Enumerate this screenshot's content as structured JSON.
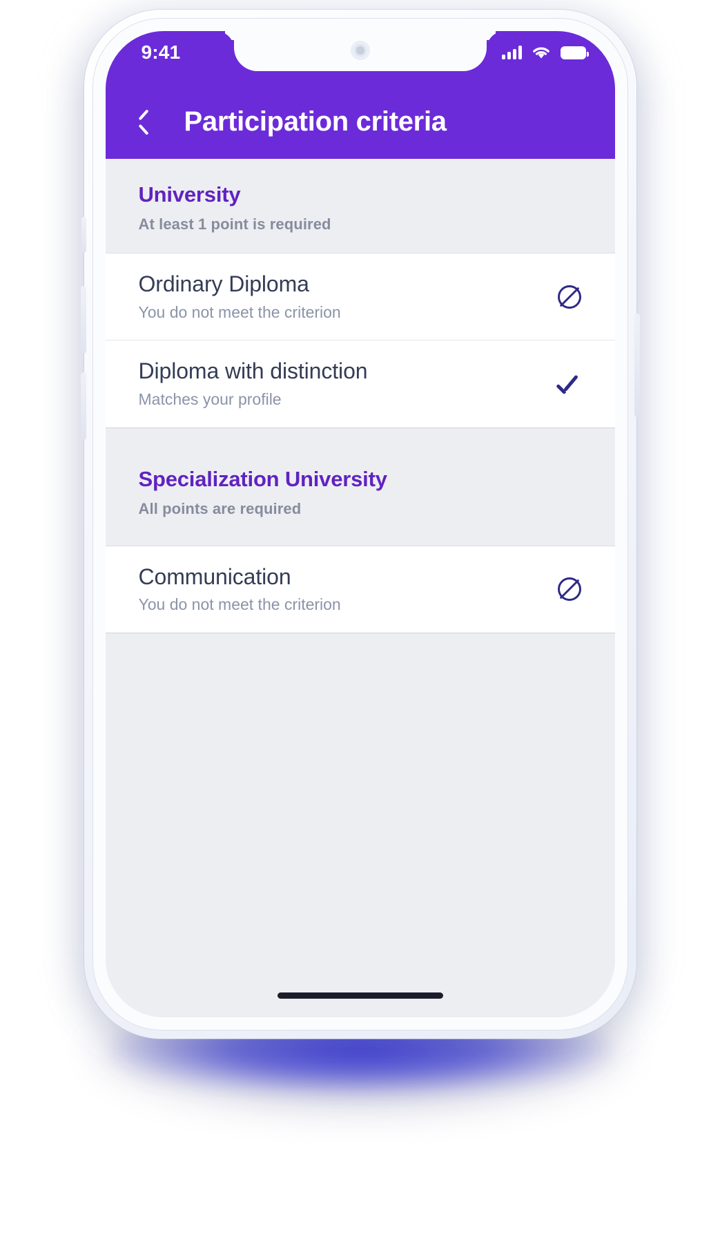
{
  "status_bar": {
    "time": "9:41",
    "icons": [
      "signal-icon",
      "wifi-icon",
      "battery-icon"
    ]
  },
  "header": {
    "title": "Participation criteria",
    "back_icon": "chevron-left-icon",
    "background_color": "#6c2bd9"
  },
  "colors": {
    "accent_purple": "#6c2bd9",
    "section_title_purple": "#6023c0",
    "icon_navy": "#2d2a86",
    "page_background": "#edeef2",
    "row_background": "#ffffff",
    "row_title": "#343c55",
    "row_subtitle": "#8b93a8",
    "section_subtitle": "#868c9d"
  },
  "sections": [
    {
      "title": "University",
      "subtitle": "At least 1 point is required",
      "items": [
        {
          "title": "Ordinary Diploma",
          "subtitle": "You do not meet the criterion",
          "status_icon": "circle-slash-icon"
        },
        {
          "title": "Diploma with distinction",
          "subtitle": "Matches your profile",
          "status_icon": "check-icon"
        }
      ]
    },
    {
      "title": "Specialization University",
      "subtitle": "All points are required",
      "items": [
        {
          "title": "Communication",
          "subtitle": "You do not meet the criterion",
          "status_icon": "circle-slash-icon"
        }
      ]
    }
  ],
  "home_indicator": "home-indicator"
}
